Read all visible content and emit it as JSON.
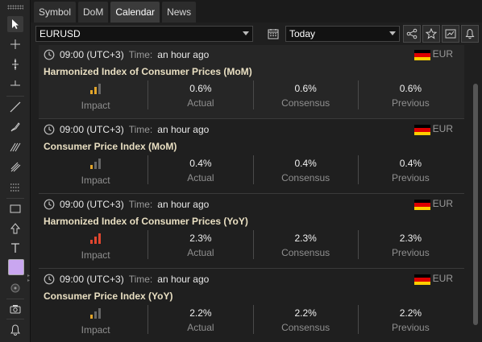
{
  "tabs": [
    {
      "label": "Symbol",
      "active": false
    },
    {
      "label": "DoM",
      "active": false
    },
    {
      "label": "Calendar",
      "active": true
    },
    {
      "label": "News",
      "active": false
    }
  ],
  "filters": {
    "symbol": "EURUSD",
    "period": "Today"
  },
  "toolbar_icons": [
    "cursor-icon",
    "crosshair-icon",
    "vertical-line-icon",
    "horizontal-line-icon",
    "trend-line-icon",
    "brush-icon",
    "fibonacci-icon",
    "pitchfork-icon",
    "grid-tool-icon",
    "rectangle-icon",
    "arrow-up-icon",
    "text-icon",
    "color-swatch",
    "circle-icon",
    "camera-icon",
    "alert-bell-icon"
  ],
  "header_buttons": [
    "share-icon",
    "star-icon",
    "chart-icon",
    "bell-icon"
  ],
  "labels": {
    "time_label": "Time:",
    "impact": "Impact",
    "actual": "Actual",
    "consensus": "Consensus",
    "previous": "Previous"
  },
  "colors": {
    "impact_low": "#e2a52b",
    "impact_high": "#e0462f",
    "bar_inactive": "#666666",
    "title": "#e9dfc2"
  },
  "events": [
    {
      "time": "09:00 (UTC+3)",
      "relative": "an hour ago",
      "currency": "EUR",
      "title": "Harmonized Index of Consumer Prices (MoM)",
      "impact_level": 2,
      "impact_color": "#e2a52b",
      "actual": "0.6%",
      "consensus": "0.6%",
      "previous": "0.6%"
    },
    {
      "time": "09:00 (UTC+3)",
      "relative": "an hour ago",
      "currency": "EUR",
      "title": "Consumer Price Index (MoM)",
      "impact_level": 1,
      "impact_color": "#e2a52b",
      "actual": "0.4%",
      "consensus": "0.4%",
      "previous": "0.4%"
    },
    {
      "time": "09:00 (UTC+3)",
      "relative": "an hour ago",
      "currency": "EUR",
      "title": "Harmonized Index of Consumer Prices (YoY)",
      "impact_level": 3,
      "impact_color": "#e0462f",
      "actual": "2.3%",
      "consensus": "2.3%",
      "previous": "2.3%"
    },
    {
      "time": "09:00 (UTC+3)",
      "relative": "an hour ago",
      "currency": "EUR",
      "title": "Consumer Price Index (YoY)",
      "impact_level": 1,
      "impact_color": "#e2a52b",
      "actual": "2.2%",
      "consensus": "2.2%",
      "previous": "2.2%"
    }
  ]
}
